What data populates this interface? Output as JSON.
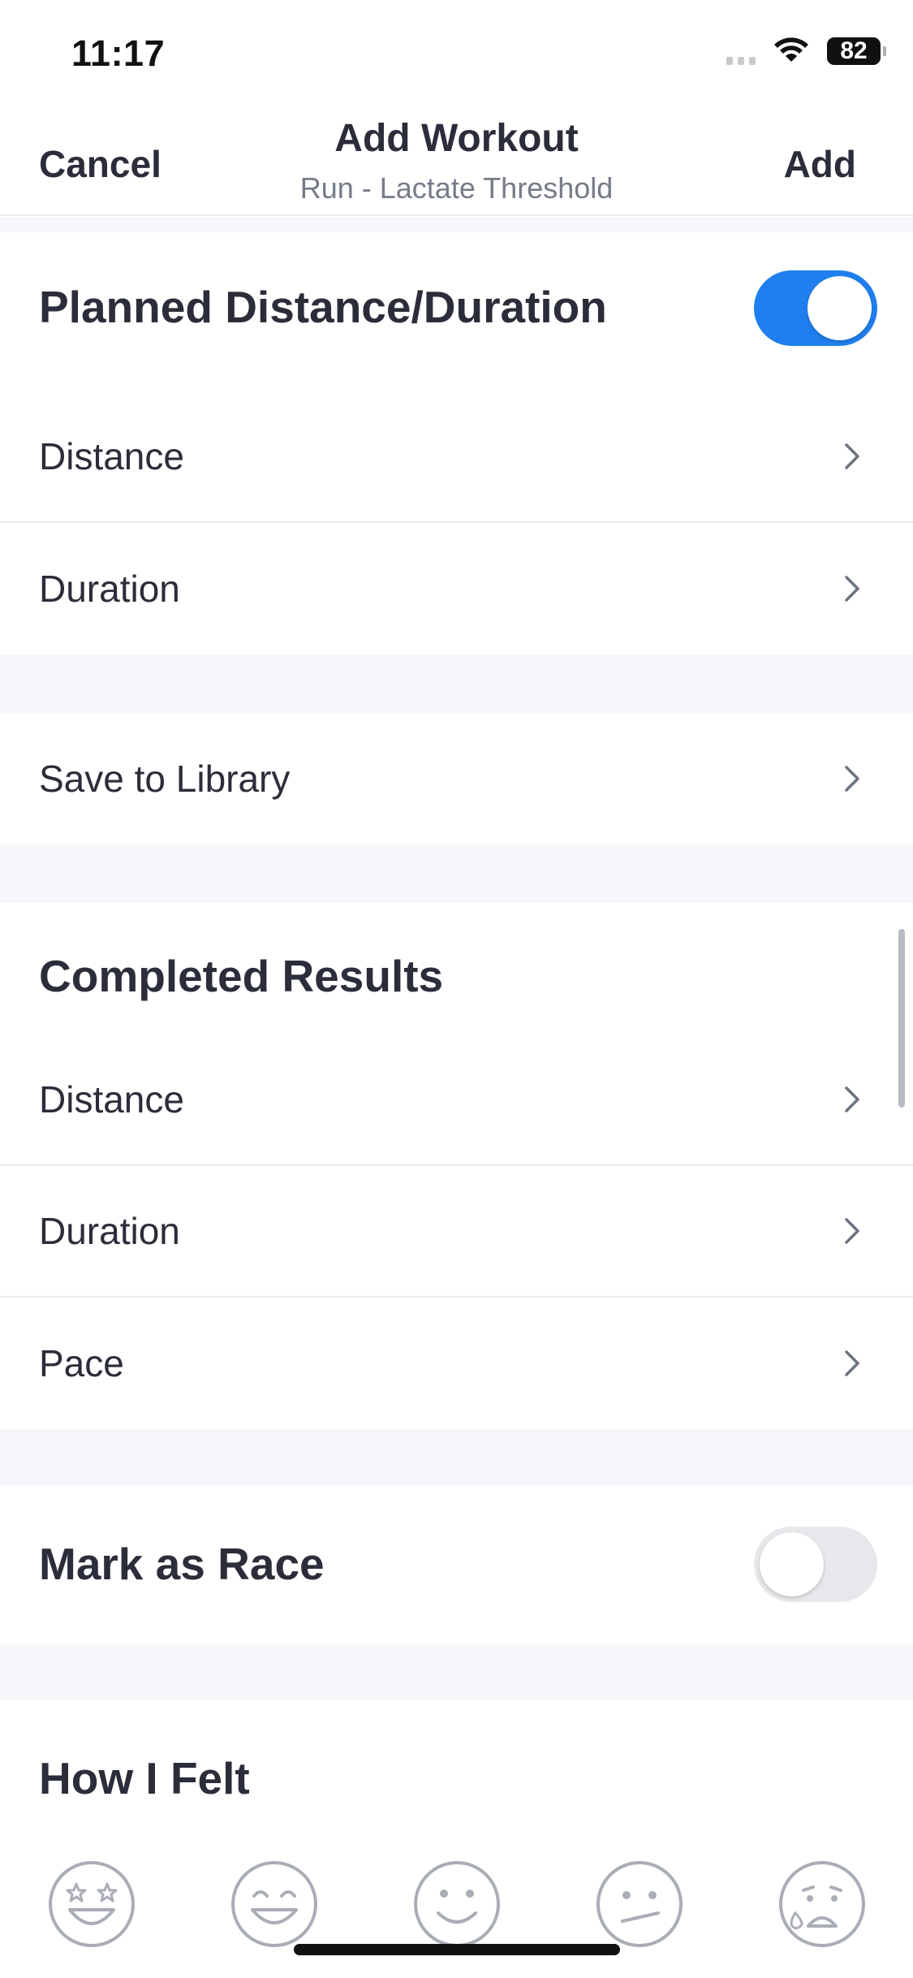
{
  "status_bar": {
    "time": "11:17",
    "battery": "82"
  },
  "nav": {
    "cancel_label": "Cancel",
    "title": "Add Workout",
    "subtitle": "Run - Lactate Threshold",
    "add_label": "Add"
  },
  "planned": {
    "header": "Planned Distance/Duration",
    "toggle_on": true,
    "rows": [
      "Distance",
      "Duration"
    ]
  },
  "library": {
    "label": "Save to Library"
  },
  "completed": {
    "header": "Completed Results",
    "rows": [
      "Distance",
      "Duration",
      "Pace"
    ]
  },
  "race": {
    "label": "Mark as Race",
    "toggle_on": false
  },
  "how_i_felt": {
    "header": "How I Felt",
    "faces": [
      "star-struck-face-icon",
      "grinning-face-icon",
      "smiling-face-icon",
      "uneasy-face-icon",
      "anxious-sweat-face-icon"
    ]
  },
  "colors": {
    "accent": "#1f7fee",
    "text": "#2b2d3a",
    "secondary_text": "#767b88",
    "background": "#f5f7fa"
  }
}
